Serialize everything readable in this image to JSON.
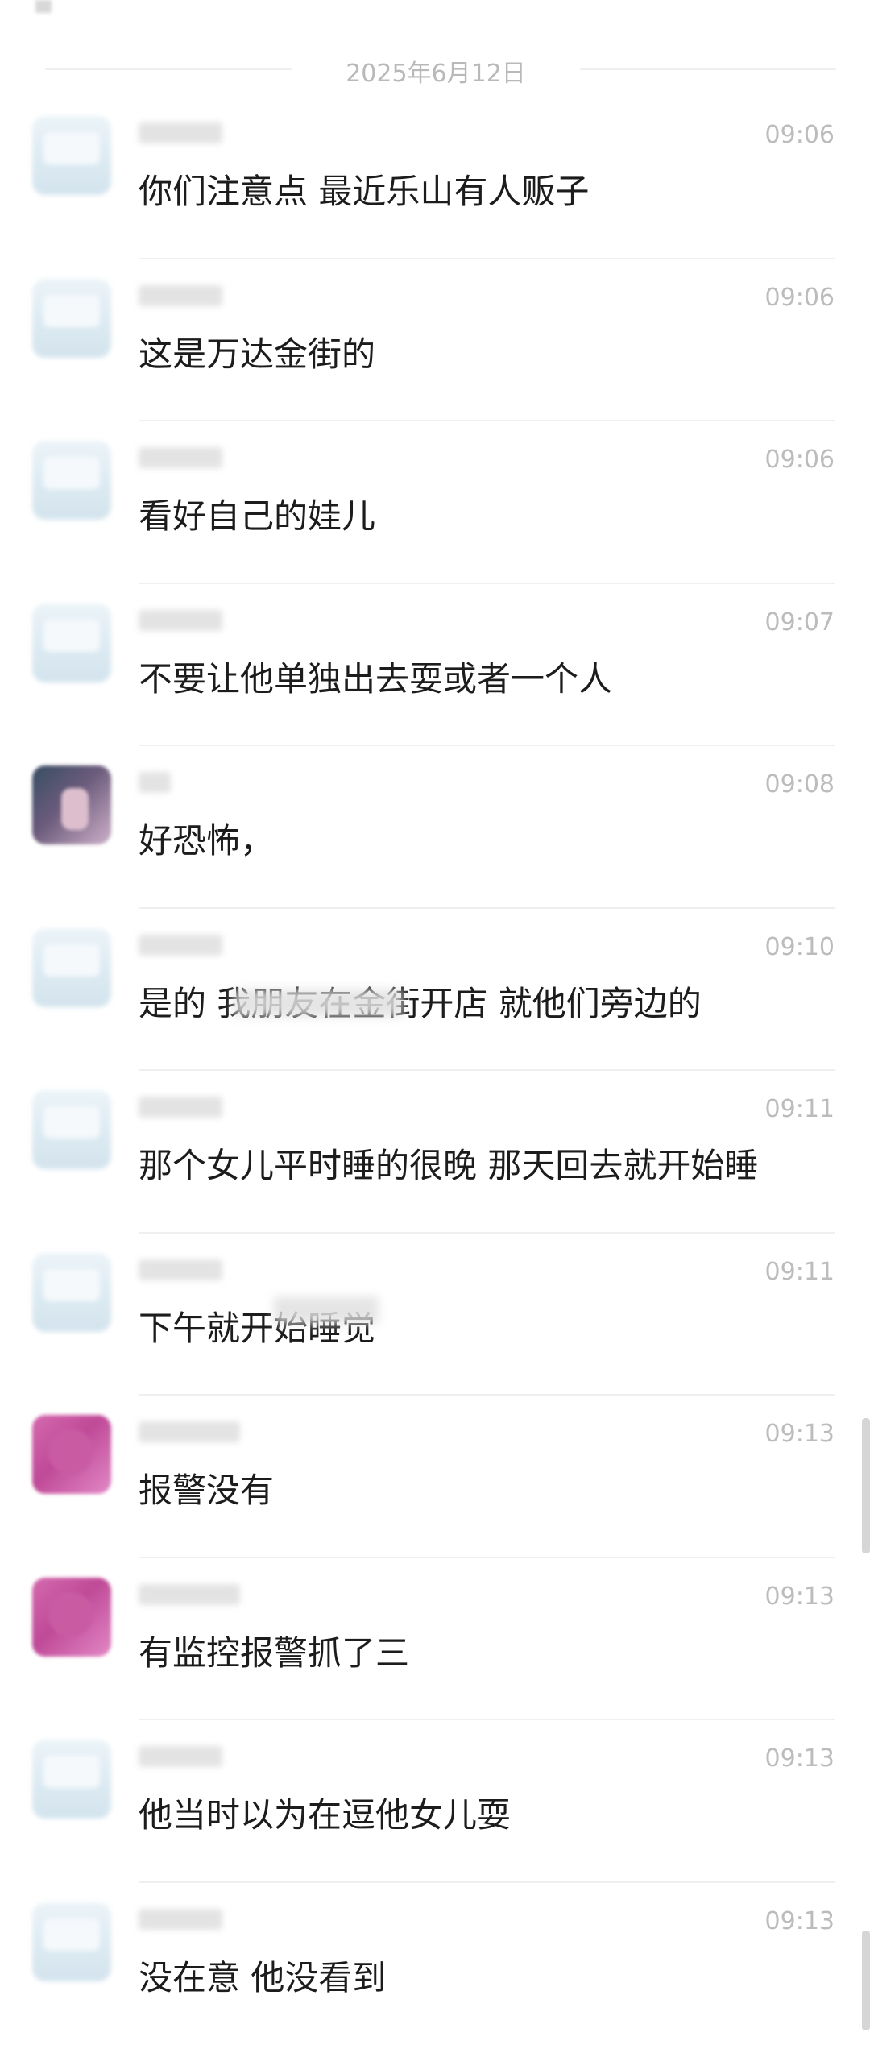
{
  "date_divider": "2025年6月12日",
  "colors": {
    "background": "#ffffff",
    "text": "#1c1c1c",
    "muted": "#bcbcbc",
    "divider": "#efefef"
  },
  "messages": [
    {
      "time": "09:06",
      "text": "你们注意点 最近乐山有人贩子",
      "avatar": "default"
    },
    {
      "time": "09:06",
      "text": "这是万达金街的",
      "avatar": "default"
    },
    {
      "time": "09:06",
      "text": "看好自己的娃儿",
      "avatar": "default"
    },
    {
      "time": "09:07",
      "text": "不要让他单独出去耍或者一个人",
      "avatar": "default"
    },
    {
      "time": "09:08",
      "text": "好恐怖，",
      "avatar": "dark"
    },
    {
      "time": "09:10",
      "text": "是的 我朋友在金街开店 就他们旁边的",
      "avatar": "default"
    },
    {
      "time": "09:11",
      "text": "那个女儿平时睡的很晚 那天回去就开始睡",
      "avatar": "default"
    },
    {
      "time": "09:11",
      "text": "下午就开始睡觉",
      "avatar": "default"
    },
    {
      "time": "09:13",
      "text": "报警没有",
      "avatar": "pink"
    },
    {
      "time": "09:13",
      "text": "有监控报警抓了三",
      "avatar": "pink"
    },
    {
      "time": "09:13",
      "text": "他当时以为在逗他女儿耍",
      "avatar": "default"
    },
    {
      "time": "09:13",
      "text": "没在意 他没看到",
      "avatar": "default"
    }
  ]
}
